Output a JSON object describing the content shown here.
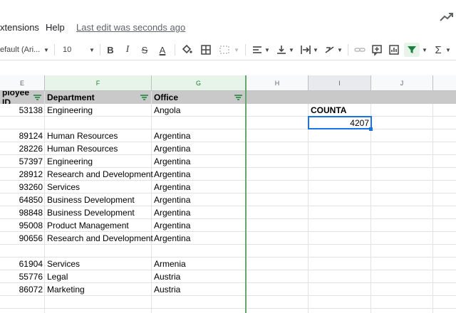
{
  "menu": {
    "extensions": "xtensions",
    "help": "Help",
    "last_edit": "Last edit was seconds ago"
  },
  "toolbar": {
    "font_name": "efault (Ari...",
    "font_size": "10",
    "bold": "B",
    "italic": "I",
    "strike": "S",
    "text_color": "A",
    "sum": "Σ"
  },
  "columns": [
    {
      "id": "E",
      "label": "E"
    },
    {
      "id": "F",
      "label": "F"
    },
    {
      "id": "G",
      "label": "G"
    },
    {
      "id": "H",
      "label": "H"
    },
    {
      "id": "I",
      "label": "I"
    },
    {
      "id": "J",
      "label": "J"
    }
  ],
  "header_row": {
    "employee_id": "ployee ID",
    "department": "Department",
    "office": "Office"
  },
  "rows": [
    {
      "id": "53138",
      "dept": "Engineering",
      "office": "Angola"
    },
    {
      "id": "",
      "dept": "",
      "office": ""
    },
    {
      "id": "89124",
      "dept": "Human Resources",
      "office": "Argentina"
    },
    {
      "id": "28226",
      "dept": "Human Resources",
      "office": "Argentina"
    },
    {
      "id": "57397",
      "dept": "Engineering",
      "office": "Argentina"
    },
    {
      "id": "28912",
      "dept": "Research and Development",
      "office": "Argentina"
    },
    {
      "id": "93260",
      "dept": "Services",
      "office": "Argentina"
    },
    {
      "id": "64850",
      "dept": "Business Development",
      "office": "Argentina"
    },
    {
      "id": "98848",
      "dept": "Business Development",
      "office": "Argentina"
    },
    {
      "id": "95008",
      "dept": "Product Management",
      "office": "Argentina"
    },
    {
      "id": "90656",
      "dept": "Research and Development",
      "office": "Argentina"
    },
    {
      "id": "",
      "dept": "",
      "office": ""
    },
    {
      "id": "61904",
      "dept": "Services",
      "office": "Armenia"
    },
    {
      "id": "55776",
      "dept": "Legal",
      "office": "Austria"
    },
    {
      "id": "86072",
      "dept": "Marketing",
      "office": "Austria"
    },
    {
      "id": "",
      "dept": "",
      "office": ""
    },
    {
      "id": "",
      "dept": "",
      "office": ""
    }
  ],
  "counta": {
    "label": "COUNTA",
    "value": "4207"
  },
  "colors": {
    "filter_green": "#188038",
    "header_gray": "#c9c9c9",
    "selection_blue": "#1a73e8",
    "freeze_line": "#64a86d"
  }
}
